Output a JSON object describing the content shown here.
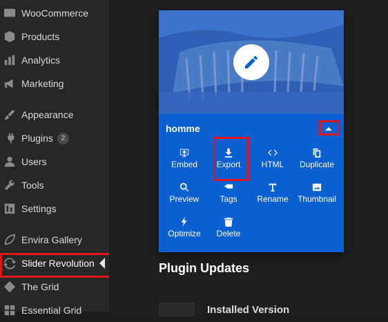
{
  "sidebar": {
    "items": [
      {
        "label": "WooCommerce",
        "icon": "woo-icon"
      },
      {
        "label": "Products",
        "icon": "products-icon"
      },
      {
        "label": "Analytics",
        "icon": "analytics-icon"
      },
      {
        "label": "Marketing",
        "icon": "megaphone-icon"
      },
      {
        "label": "Appearance",
        "icon": "brush-icon"
      },
      {
        "label": "Plugins",
        "icon": "plugin-icon",
        "badge": "2"
      },
      {
        "label": "Users",
        "icon": "user-icon"
      },
      {
        "label": "Tools",
        "icon": "wrench-icon"
      },
      {
        "label": "Settings",
        "icon": "settings-icon"
      },
      {
        "label": "Envira Gallery",
        "icon": "leaf-icon"
      },
      {
        "label": "Slider Revolution",
        "icon": "refresh-icon"
      },
      {
        "label": "The Grid",
        "icon": "grid-diamond-icon"
      },
      {
        "label": "Essential Grid",
        "icon": "grid-icon"
      }
    ]
  },
  "card": {
    "title": "homme",
    "actions": [
      {
        "label": "Embed",
        "icon": "embed-icon"
      },
      {
        "label": "Export",
        "icon": "download-icon"
      },
      {
        "label": "HTML",
        "icon": "code-icon"
      },
      {
        "label": "Duplicate",
        "icon": "copy-icon"
      },
      {
        "label": "Preview",
        "icon": "search-icon"
      },
      {
        "label": "Tags",
        "icon": "tag-icon"
      },
      {
        "label": "Rename",
        "icon": "text-icon"
      },
      {
        "label": "Thumbnail",
        "icon": "image-icon"
      },
      {
        "label": "Optimize",
        "icon": "bolt-icon"
      },
      {
        "label": "Delete",
        "icon": "trash-icon"
      }
    ]
  },
  "main": {
    "section_title": "Plugin Updates",
    "table_header": "Installed Version"
  },
  "colors": {
    "sidebar_bg": "#272727",
    "card_blue": "#0a5fd1",
    "highlight_red": "#e0151d"
  }
}
